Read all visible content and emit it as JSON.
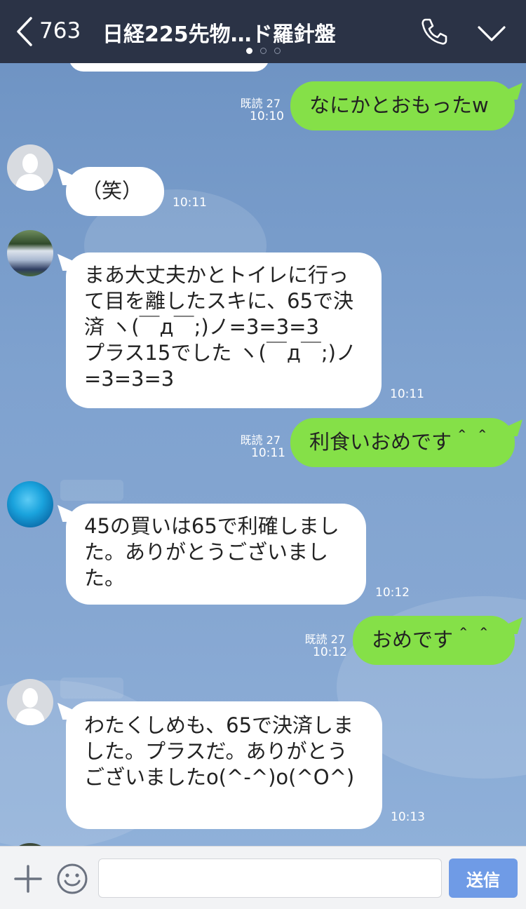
{
  "header": {
    "back_count": "763",
    "title": "日経225先物…ド羅針盤",
    "colors": {
      "bar": "#2b3346"
    }
  },
  "messages": [
    {
      "side": "out",
      "text": "なにかとおもったw",
      "read": "既読 27",
      "time": "10:10"
    },
    {
      "side": "in",
      "avatar": "default",
      "text": "（笑）",
      "time": "10:11"
    },
    {
      "side": "in",
      "avatar": "car",
      "text": "まあ大丈夫かとトイレに行っ\nて目を離したスキに、65で決\n済 ヽ(￣д￣;)ノ=3=3=3\nプラス15でした ヽ(￣д￣;)ノ\n=3=3=3",
      "time": "10:11"
    },
    {
      "side": "out",
      "text": "利食いおめです＾＾",
      "read": "既読 27",
      "time": "10:11"
    },
    {
      "side": "in",
      "avatar": "sea",
      "text": "45の買いは65で利確しまし\nた。ありがとうございまし\nた。",
      "time": "10:12"
    },
    {
      "side": "out",
      "text": "おめです＾＾",
      "read": "既読 27",
      "time": "10:12"
    },
    {
      "side": "in",
      "avatar": "default",
      "text": "わたくしめも、65で決済しま\nした。プラスだ。ありがとう\nございましたo(^-^)o(^O^)",
      "time": "10:13"
    }
  ],
  "inputbar": {
    "send_label": "送信",
    "placeholder": ""
  },
  "icons": {
    "back": "chevron-left-icon",
    "call": "phone-icon",
    "menu": "chevron-down-icon",
    "attach": "plus-icon",
    "sticker": "smiley-icon"
  },
  "colors": {
    "outgoing_bubble": "#85e048",
    "incoming_bubble": "#ffffff",
    "send_button": "#6f9be6"
  }
}
